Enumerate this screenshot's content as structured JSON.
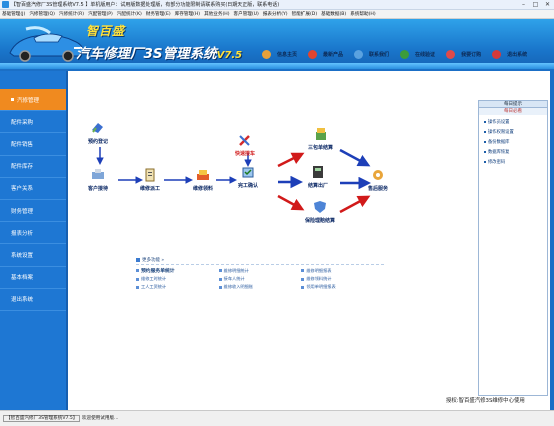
{
  "window": {
    "title": "【智百盛汽修厂3S管理系统V7.5 】单机版用户：试用版数据处理版，有部分功能限制请联系购买(日期天正版，联系电话)"
  },
  "menu": {
    "items": [
      "基础管理(J)",
      "汽修管理(Q)",
      "汽修统计(R)",
      "汽配管理(P)",
      "汽配统计(K)",
      "财务管理(E)",
      "库存管理(H)",
      "其他业务(H)",
      "客户管理(U)",
      "报表分析(Y)",
      "智能扩展(D)",
      "基础数据(B)",
      "系统帮助(H)"
    ]
  },
  "banner": {
    "brand": "智百盛",
    "product": "汽车修理厂3S管理系统",
    "version": "V7.5",
    "links": [
      {
        "label": "信息主页",
        "icon": "home-icon",
        "color": "#e8a13a"
      },
      {
        "label": "最新产品",
        "icon": "product-icon",
        "color": "#e2452f"
      },
      {
        "label": "联系我们",
        "icon": "contact-icon",
        "color": "#5aa2e0"
      },
      {
        "label": "在线验证",
        "icon": "verify-icon",
        "color": "#3c9c3c"
      },
      {
        "label": "我要订购",
        "icon": "order-icon",
        "color": "#e04a4a"
      },
      {
        "label": "退出系统",
        "icon": "exit-icon",
        "color": "#d63a3a"
      }
    ]
  },
  "sidebar": {
    "items": [
      "汽修管理",
      "配件采购",
      "配件销售",
      "配件库存",
      "客户关系",
      "财务管理",
      "报表分析",
      "系统设置",
      "基本档案",
      "退出系统"
    ],
    "active": "汽修管理"
  },
  "flow": {
    "nodes": {
      "reserve": "预约登记",
      "customer": "客户接待",
      "dispatch": "维修派工",
      "material": "维修领料",
      "finish": "完工确认",
      "quick": "快速接车",
      "settle3": "三包单结算",
      "checkout": "结算出厂",
      "insurance": "保险理赔结算",
      "revisit": "售后服务"
    }
  },
  "right_panel": {
    "header": "每日提示",
    "subheader": "每日必看",
    "items": [
      "操作员设置",
      "操作权限设置",
      "备份数据库",
      "数据库恢复",
      "修改密码"
    ]
  },
  "quick": {
    "header": "更多功能",
    "items": [
      "预约服务单统计",
      "维修明细统计",
      "维修明细报表",
      "维修工时统计",
      "接车人统计",
      "维修领料统计",
      "工人工资统计",
      "维修收入明细账",
      "领用单明细报表"
    ]
  },
  "credit": "授权:智百盛汽修3S维修中心使用",
  "status": {
    "left": "【智百盛汽修厂3S管理系统V7.5】",
    "text": "欢迎使用试用版..."
  }
}
